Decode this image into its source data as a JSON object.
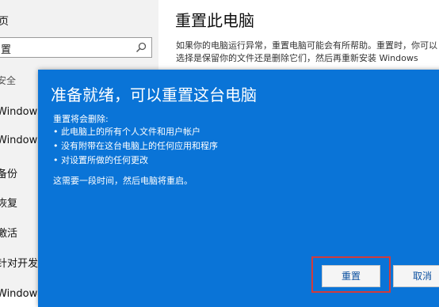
{
  "sidebar": {
    "home_label": "页",
    "search_placeholder": "置",
    "section_label": "安全",
    "items": [
      {
        "label": "Windows 更"
      },
      {
        "label": "Windows D"
      },
      {
        "label": "备份"
      },
      {
        "label": "恢复"
      },
      {
        "label": "激活"
      },
      {
        "label": "针对开发人"
      },
      {
        "label": "Windows 预"
      }
    ]
  },
  "main": {
    "title": "重置此电脑",
    "description": "如果你的电脑运行异常，重置电脑可能会有所帮助。重置时，你可以选择是保留你的文件还是删除它们，然后再重新安装 Windows"
  },
  "dialog": {
    "title": "准备就绪，可以重置这台电脑",
    "intro": "重置将会删除:",
    "items": [
      "此电脑上的所有个人文件和用户帐户",
      "没有附带在这台电脑上的任何应用和程序",
      "对设置所做的任何更改"
    ],
    "bullet": "•",
    "note": "这需要一段时间，然后电脑将重启。",
    "reset_label": "重置",
    "cancel_label": "取消"
  },
  "colors": {
    "dialog_bg": "#0a74d7",
    "highlight": "#d23b3b",
    "sidebar_bg": "#f2f2f2"
  }
}
